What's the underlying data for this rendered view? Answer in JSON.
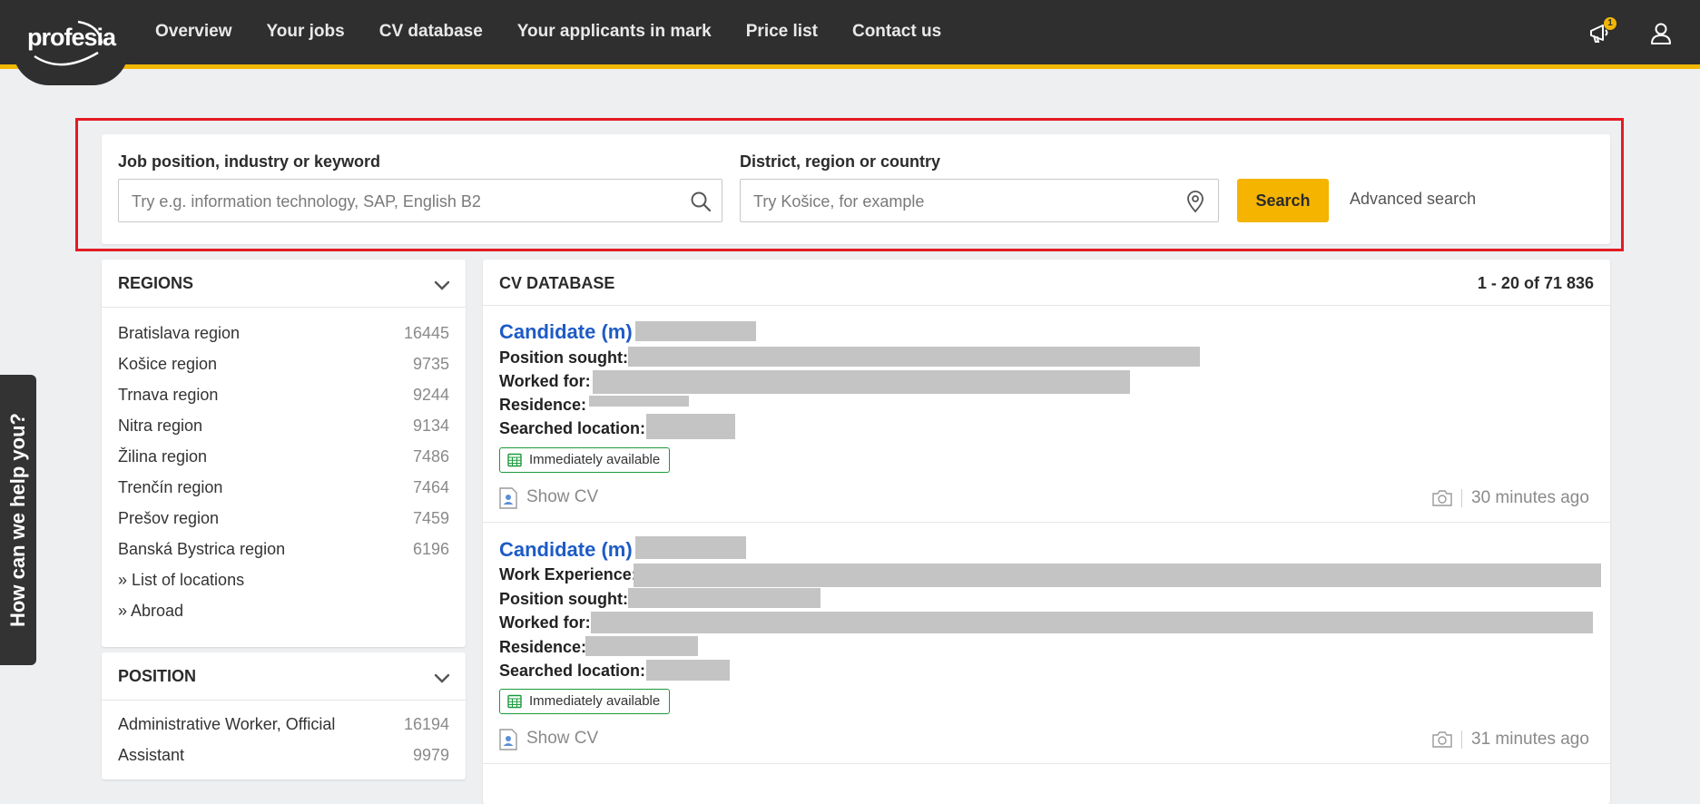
{
  "brand": {
    "logo_text": "profesia",
    "accent": "#f2b705",
    "nav_bg": "#2f2f2f",
    "link_blue": "#1e5bc6"
  },
  "nav": {
    "items": [
      "Overview",
      "Your jobs",
      "CV database",
      "Your applicants in mark",
      "Price list",
      "Contact us"
    ],
    "notification_count": "1",
    "icons": [
      "megaphone-icon",
      "user-icon"
    ]
  },
  "search": {
    "keyword_label": "Job position, industry or keyword",
    "keyword_placeholder": "Try e.g. information technology, SAP, English B2",
    "keyword_value": "",
    "location_label": "District, region or country",
    "location_placeholder": "Try Košice, for example",
    "location_value": "",
    "search_button": "Search",
    "advanced_link": "Advanced search"
  },
  "help_tab": {
    "label": "How can we help you?"
  },
  "regions": {
    "title": "REGIONS",
    "items": [
      {
        "label": "Bratislava region",
        "count": "16445"
      },
      {
        "label": "Košice region",
        "count": "9735"
      },
      {
        "label": "Trnava region",
        "count": "9244"
      },
      {
        "label": "Nitra region",
        "count": "9134"
      },
      {
        "label": "Žilina region",
        "count": "7486"
      },
      {
        "label": "Trenčín region",
        "count": "7464"
      },
      {
        "label": "Prešov region",
        "count": "7459"
      },
      {
        "label": "Banská Bystrica region",
        "count": "6196"
      }
    ],
    "links": [
      "» List of locations",
      "» Abroad"
    ]
  },
  "position": {
    "title": "POSITION",
    "items": [
      {
        "label": "Administrative Worker, Official",
        "count": "16194"
      },
      {
        "label": "Assistant",
        "count": "9979"
      }
    ]
  },
  "results": {
    "title": "CV DATABASE",
    "count": "1 - 20 of 71 836",
    "candidates": [
      {
        "name": "Candidate (m)",
        "fields": [
          "Position sought:",
          "Worked for:",
          "Residence:",
          "Searched location:"
        ],
        "badge": "Immediately available",
        "show_cv": "Show CV",
        "time": "30 minutes ago"
      },
      {
        "name": "Candidate (m)",
        "fields": [
          "Work Experience:",
          "Position sought:",
          "Worked for:",
          "Residence:",
          "Searched location:"
        ],
        "badge": "Immediately available",
        "show_cv": "Show CV",
        "time": "31 minutes ago"
      }
    ]
  }
}
